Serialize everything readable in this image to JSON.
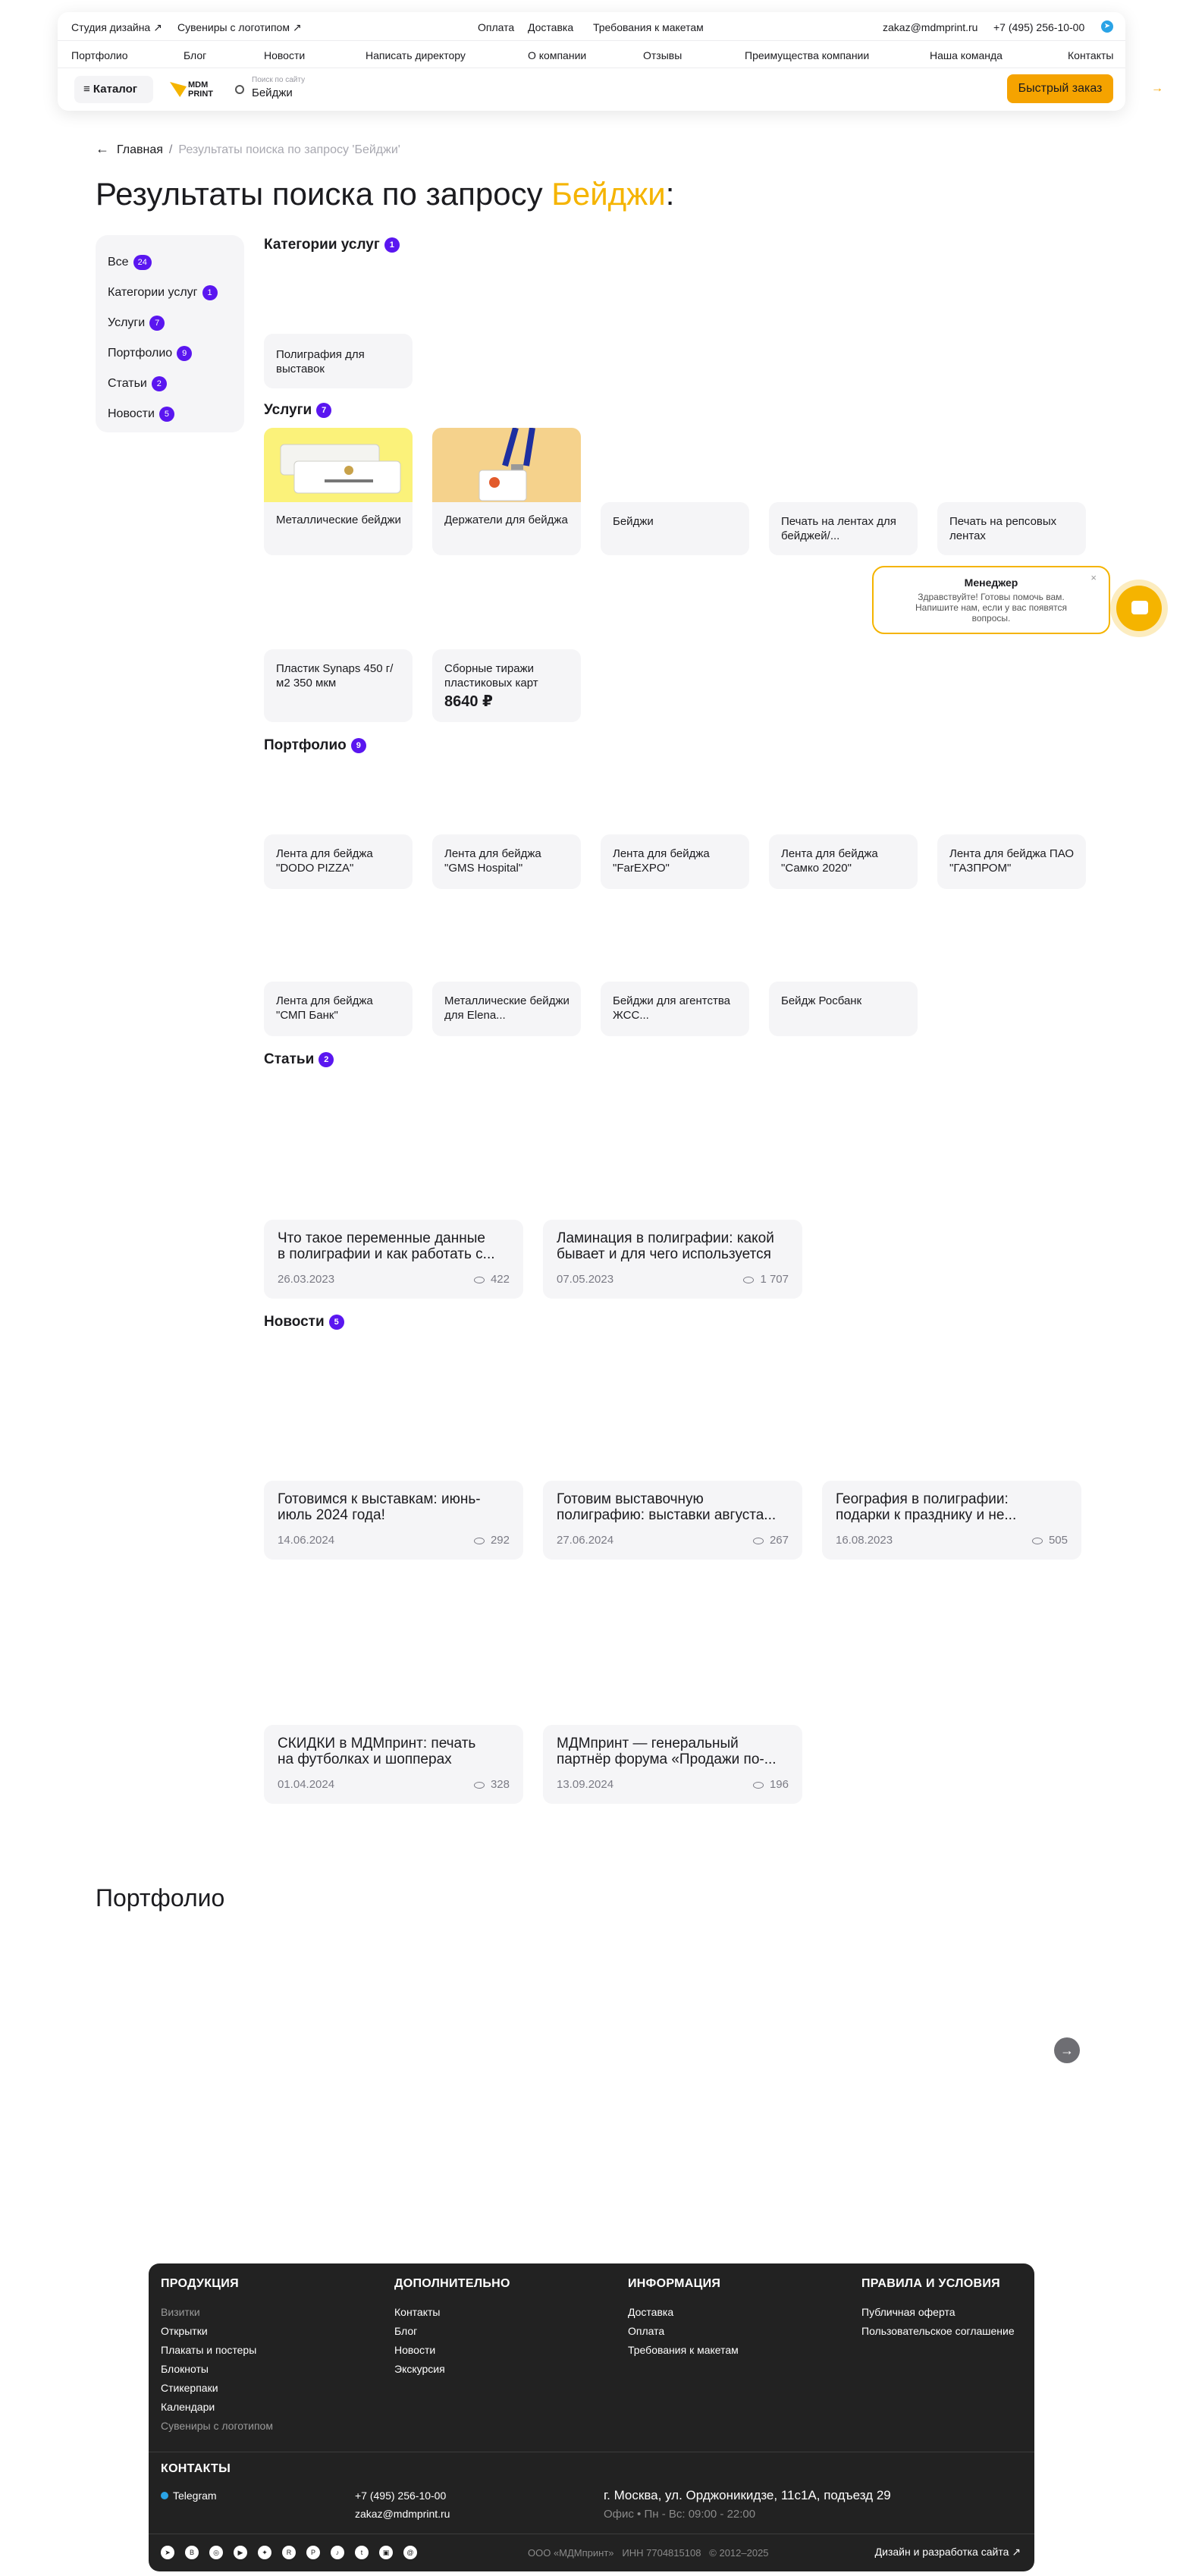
{
  "header": {
    "top_left": [
      "Студия дизайна ↗",
      "Сувениры с логотипом ↗"
    ],
    "top_center": [
      "Оплата",
      "Доставка",
      "Требования к макетам"
    ],
    "email": "zakaz@mdmprint.ru",
    "phone": "+7 (495) 256-10-00",
    "nav": [
      "Портфолио",
      "Блог",
      "Новости",
      "Написать директору",
      "О компании",
      "Отзывы",
      "Преимущества компании",
      "Наша команда",
      "Контакты"
    ],
    "catalog_label": "Каталог",
    "logo_text": "MDM PRINT",
    "search_placeholder": "Поиск по сайту",
    "search_value": "Бейджи",
    "quick_order": "Быстрый заказ"
  },
  "breadcrumbs": {
    "home": "Главная",
    "current": "Результаты поиска по запросу 'Бейджи'"
  },
  "title": {
    "prefix": "Результаты поиска по запросу ",
    "query": "Бейджи",
    "suffix": ":"
  },
  "filters": [
    {
      "label": "Все",
      "count": "24"
    },
    {
      "label": "Категории услуг",
      "count": "1"
    },
    {
      "label": "Услуги",
      "count": "7"
    },
    {
      "label": "Портфолио",
      "count": "9"
    },
    {
      "label": "Статьи",
      "count": "2"
    },
    {
      "label": "Новости",
      "count": "5"
    }
  ],
  "sections": {
    "categories": {
      "title": "Категории услуг",
      "count": "1",
      "items": [
        "Полиграфия для выставок"
      ]
    },
    "services": {
      "title": "Услуги",
      "count": "7",
      "items": [
        "Металлические бейджи",
        "Держатели для бейджа",
        "Бейджи",
        "Печать на лентах для бейджей/...",
        "Печать на репсовых лентах",
        "Пластик Synaps 450 г/м2 350 мкм",
        "Сборные тиражи пластиковых карт"
      ],
      "price": "8640 ₽"
    },
    "portfolio": {
      "title": "Портфолио",
      "count": "9",
      "items": [
        "Лента для бейджа \"DODO PIZZA\"",
        "Лента для бейджа \"GMS Hospital\"",
        "Лента для бейджа \"FarEXPO\"",
        "Лента для бейджа \"Самко 2020\"",
        "Лента для бейджа ПАО \"ГАЗПРОМ\"",
        "Лента для бейджа \"СМП Банк\"",
        "Металлические бейджи для Elena...",
        "Бейджи для агентства ЖСС...",
        "Бейдж Росбанк"
      ]
    },
    "articles": {
      "title": "Статьи",
      "count": "2",
      "items": [
        {
          "l1": "Что такое переменные данные",
          "l2": "в полиграфии и как работать с...",
          "date": "26.03.2023",
          "views": "422"
        },
        {
          "l1": "Ламинация в полиграфии: какой",
          "l2": "бывает и для чего используется",
          "date": "07.05.2023",
          "views": "1 707"
        }
      ]
    },
    "news": {
      "title": "Новости",
      "count": "5",
      "items": [
        {
          "l1": "Готовимся к выставкам: июнь-",
          "l2": "июль 2024 года!",
          "date": "14.06.2024",
          "views": "292"
        },
        {
          "l1": "Готовим выставочную",
          "l2": "полиграфию: выставки августа...",
          "date": "27.06.2024",
          "views": "267"
        },
        {
          "l1": "География в полиграфии:",
          "l2": "подарки к празднику и не...",
          "date": "16.08.2023",
          "views": "505"
        },
        {
          "l1": "СКИДКИ в МДМпринт: печать",
          "l2": "на футболках и шопперах",
          "date": "01.04.2024",
          "views": "328"
        },
        {
          "l1": "МДМпринт — генеральный",
          "l2": "партнёр форума «Продажи по-...",
          "date": "13.09.2024",
          "views": "196"
        }
      ]
    }
  },
  "manager": {
    "name": "Менеджер",
    "text": "Здравствуйте! Готовы помочь вам. Напишите нам, если у вас появятся вопросы."
  },
  "portfolio_block": {
    "title": "Портфолио"
  },
  "footer": {
    "products": {
      "title": "ПРОДУКЦИЯ",
      "items": [
        "Визитки",
        "Открытки",
        "Плакаты и постеры",
        "Блокноты",
        "Стикерпаки",
        "Календари",
        "Сувениры с логотипом"
      ]
    },
    "extra": {
      "title": "ДОПОЛНИТЕЛЬНО",
      "items": [
        "Контакты",
        "Блог",
        "Новости",
        "Экскурсия"
      ]
    },
    "info": {
      "title": "ИНФОРМАЦИЯ",
      "items": [
        "Доставка",
        "Оплата",
        "Требования к макетам"
      ]
    },
    "rules": {
      "title": "ПРАВИЛА И УСЛОВИЯ",
      "items": [
        "Публичная оферта",
        "Пользовательское соглашение"
      ]
    },
    "contacts_title": "КОНТАКТЫ",
    "telegram": "Telegram",
    "phone": "+7 (495) 256-10-00",
    "email": "zakaz@mdmprint.ru",
    "address": "г. Москва, ул. Орджоникидзе, 11с1А, подъезд 29",
    "office_hours": "Офис • Пн - Вс: 09:00 - 22:00",
    "company": "ООО «МДМпринт»",
    "inn": "ИНН 7704815108",
    "years": "© 2012–2025",
    "dev": "Дизайн и разработка сайта ↗"
  }
}
